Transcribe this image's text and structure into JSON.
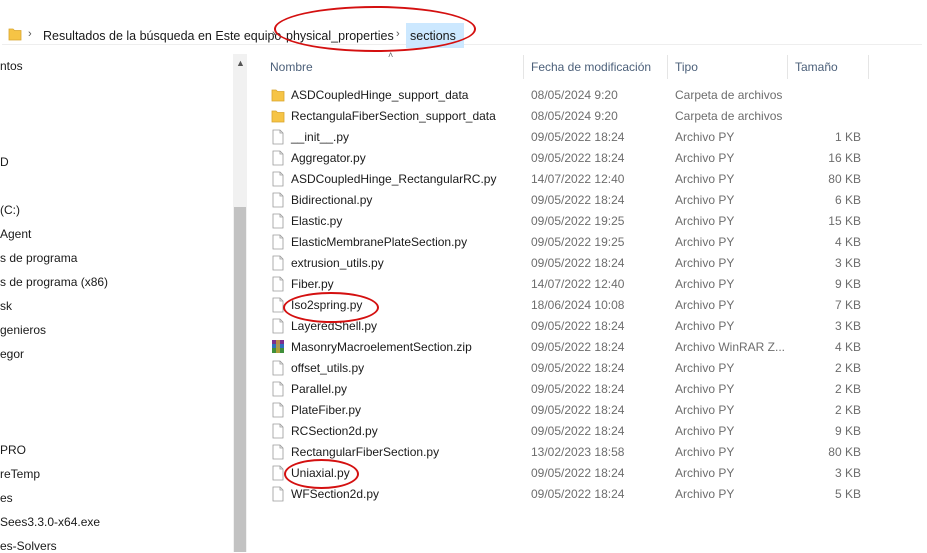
{
  "breadcrumb": {
    "root": "Resultados de la búsqueda en Este equipo",
    "folder1": "physical_properties",
    "folder2": "sections"
  },
  "nav": {
    "items": [
      "ntos",
      "",
      "",
      "D",
      "",
      " (C:)",
      "Agent",
      "s de programa",
      "s de programa (x86)",
      "sk",
      "genieros",
      "egor",
      "",
      "",
      "PRO",
      "reTemp",
      "es",
      "Sees3.3.0-x64.exe",
      "es-Solvers"
    ]
  },
  "columns": {
    "name": "Nombre",
    "date": "Fecha de modificación",
    "type": "Tipo",
    "size": "Tamaño"
  },
  "files": [
    {
      "icon": "folder-icon",
      "name": "ASDCoupledHinge_support_data",
      "date": "08/05/2024 9:20",
      "type": "Carpeta de archivos",
      "size": ""
    },
    {
      "icon": "folder-icon",
      "name": "RectangulaFiberSection_support_data",
      "date": "08/05/2024 9:20",
      "type": "Carpeta de archivos",
      "size": ""
    },
    {
      "icon": "file-icon",
      "name": "__init__.py",
      "date": "09/05/2022 18:24",
      "type": "Archivo PY",
      "size": "1 KB"
    },
    {
      "icon": "file-icon",
      "name": "Aggregator.py",
      "date": "09/05/2022 18:24",
      "type": "Archivo PY",
      "size": "16 KB"
    },
    {
      "icon": "file-icon",
      "name": "ASDCoupledHinge_RectangularRC.py",
      "date": "14/07/2022 12:40",
      "type": "Archivo PY",
      "size": "80 KB"
    },
    {
      "icon": "file-icon",
      "name": "Bidirectional.py",
      "date": "09/05/2022 18:24",
      "type": "Archivo PY",
      "size": "6 KB"
    },
    {
      "icon": "file-icon",
      "name": "Elastic.py",
      "date": "09/05/2022 19:25",
      "type": "Archivo PY",
      "size": "15 KB"
    },
    {
      "icon": "file-icon",
      "name": "ElasticMembranePlateSection.py",
      "date": "09/05/2022 19:25",
      "type": "Archivo PY",
      "size": "4 KB"
    },
    {
      "icon": "file-icon",
      "name": "extrusion_utils.py",
      "date": "09/05/2022 18:24",
      "type": "Archivo PY",
      "size": "3 KB"
    },
    {
      "icon": "file-icon",
      "name": "Fiber.py",
      "date": "14/07/2022 12:40",
      "type": "Archivo PY",
      "size": "9 KB"
    },
    {
      "icon": "file-icon",
      "name": "Iso2spring.py",
      "date": "18/06/2024 10:08",
      "type": "Archivo PY",
      "size": "7 KB"
    },
    {
      "icon": "file-icon",
      "name": "LayeredShell.py",
      "date": "09/05/2022 18:24",
      "type": "Archivo PY",
      "size": "3 KB"
    },
    {
      "icon": "winrar-icon",
      "name": "MasonryMacroelementSection.zip",
      "date": "09/05/2022 18:24",
      "type": "Archivo WinRAR Z...",
      "size": "4 KB"
    },
    {
      "icon": "file-icon",
      "name": "offset_utils.py",
      "date": "09/05/2022 18:24",
      "type": "Archivo PY",
      "size": "2 KB"
    },
    {
      "icon": "file-icon",
      "name": "Parallel.py",
      "date": "09/05/2022 18:24",
      "type": "Archivo PY",
      "size": "2 KB"
    },
    {
      "icon": "file-icon",
      "name": "PlateFiber.py",
      "date": "09/05/2022 18:24",
      "type": "Archivo PY",
      "size": "2 KB"
    },
    {
      "icon": "file-icon",
      "name": "RCSection2d.py",
      "date": "09/05/2022 18:24",
      "type": "Archivo PY",
      "size": "9 KB"
    },
    {
      "icon": "file-icon",
      "name": "RectangularFiberSection.py",
      "date": "13/02/2023 18:58",
      "type": "Archivo PY",
      "size": "80 KB"
    },
    {
      "icon": "file-icon",
      "name": "Uniaxial.py",
      "date": "09/05/2022 18:24",
      "type": "Archivo PY",
      "size": "3 KB"
    },
    {
      "icon": "file-icon",
      "name": "WFSection2d.py",
      "date": "09/05/2022 18:24",
      "type": "Archivo PY",
      "size": "5 KB"
    }
  ],
  "colors": {
    "accent_selection": "#cce8ff",
    "annotation_red": "#d41010",
    "folder_yellow": "#f6c445"
  }
}
